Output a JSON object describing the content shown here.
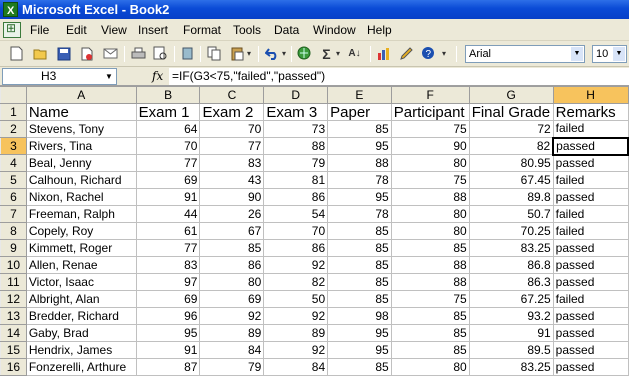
{
  "window": {
    "title": "Microsoft Excel - Book2"
  },
  "menu": [
    "File",
    "Edit",
    "View",
    "Insert",
    "Format",
    "Tools",
    "Data",
    "Window",
    "Help"
  ],
  "toolbar": {
    "font": "Arial",
    "size": "10"
  },
  "formula_bar": {
    "cell": "H3",
    "fx": "fx",
    "formula": "=IF(G3<75,\"failed\",\"passed\")"
  },
  "columns": [
    "A",
    "B",
    "C",
    "D",
    "E",
    "F",
    "G",
    "H"
  ],
  "row_numbers": [
    "1",
    "2",
    "3",
    "4",
    "5",
    "6",
    "7",
    "8",
    "9",
    "10",
    "11",
    "12",
    "13",
    "14",
    "15",
    "16"
  ],
  "header_row": [
    "Name",
    "Exam 1",
    "Exam 2",
    "Exam 3",
    "Paper",
    "Participant",
    "Final Grade",
    "Remarks"
  ],
  "rows": [
    [
      "Stevens, Tony",
      "64",
      "70",
      "73",
      "85",
      "75",
      "72",
      "failed"
    ],
    [
      "Rivers, Tina",
      "70",
      "77",
      "88",
      "95",
      "90",
      "82",
      "passed"
    ],
    [
      "Beal, Jenny",
      "77",
      "83",
      "79",
      "88",
      "80",
      "80.95",
      "passed"
    ],
    [
      "Calhoun, Richard",
      "69",
      "43",
      "81",
      "78",
      "75",
      "67.45",
      "failed"
    ],
    [
      "Nixon, Rachel",
      "91",
      "90",
      "86",
      "95",
      "88",
      "89.8",
      "passed"
    ],
    [
      "Freeman, Ralph",
      "44",
      "26",
      "54",
      "78",
      "80",
      "50.7",
      "failed"
    ],
    [
      "Copely, Roy",
      "61",
      "67",
      "70",
      "85",
      "80",
      "70.25",
      "failed"
    ],
    [
      "Kimmett, Roger",
      "77",
      "85",
      "86",
      "85",
      "85",
      "83.25",
      "passed"
    ],
    [
      "Allen, Renae",
      "83",
      "86",
      "92",
      "85",
      "88",
      "86.8",
      "passed"
    ],
    [
      "Victor, Isaac",
      "97",
      "80",
      "82",
      "85",
      "88",
      "86.3",
      "passed"
    ],
    [
      "Albright, Alan",
      "69",
      "69",
      "50",
      "85",
      "75",
      "67.25",
      "failed"
    ],
    [
      "Bredder, Richard",
      "96",
      "92",
      "92",
      "98",
      "85",
      "93.2",
      "passed"
    ],
    [
      "Gaby, Brad",
      "95",
      "89",
      "89",
      "95",
      "85",
      "91",
      "passed"
    ],
    [
      "Hendrix, James",
      "91",
      "84",
      "92",
      "95",
      "85",
      "89.5",
      "passed"
    ],
    [
      "Fonzerelli, Arthure",
      "87",
      "79",
      "84",
      "85",
      "80",
      "83.25",
      "passed"
    ]
  ],
  "selected_cell": {
    "row": 3,
    "column": "H"
  }
}
